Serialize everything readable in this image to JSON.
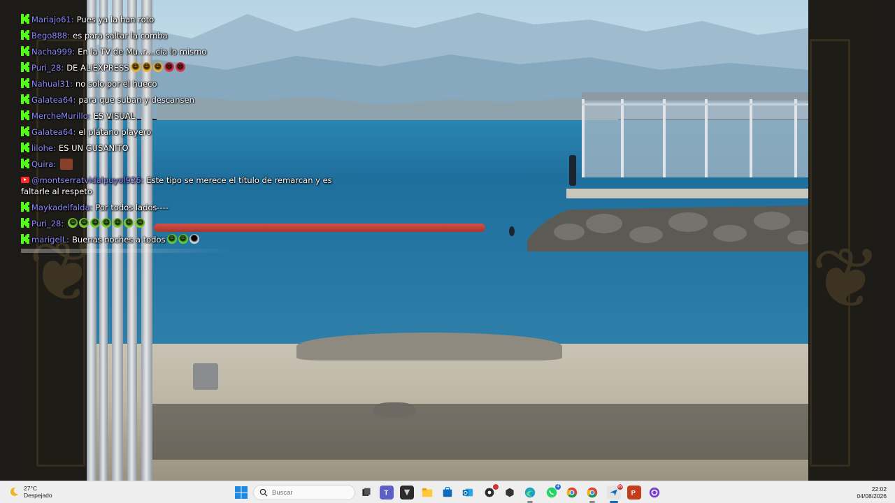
{
  "chat": {
    "messages": [
      {
        "platform": "kick",
        "user": "Mariajo61:",
        "text": "Pues ya la han roto"
      },
      {
        "platform": "kick",
        "user": "Bego888:",
        "text": "es para saltar la comba"
      },
      {
        "platform": "kick",
        "user": "Nacha999:",
        "text": "En la TV de Mu..r....cia lo mismo"
      },
      {
        "platform": "kick",
        "user": "Puri_28:",
        "text": "DE ALIEXPRESS",
        "emojis": [
          "clown",
          "clown",
          "clown",
          "angry",
          "angry"
        ]
      },
      {
        "platform": "kick",
        "user": "Nahual31:",
        "text": "no solo por el hueco"
      },
      {
        "platform": "kick",
        "user": "Galatea64:",
        "text": "para que suban y descansen"
      },
      {
        "platform": "kick",
        "user": "MercheMurillo:",
        "text": "ES VISUAL"
      },
      {
        "platform": "kick",
        "user": "Galatea64:",
        "text": "el plátano playero"
      },
      {
        "platform": "kick",
        "user": "lilohe:",
        "text": "ES UN GUSANITO"
      },
      {
        "platform": "kick",
        "user": "Quira:",
        "text": "",
        "sticker": true
      },
      {
        "platform": "youtube",
        "user": "@montserratvidalpuyol926:",
        "text": "Este tipo se merece el título de remarcan y es faltarle al respeto"
      },
      {
        "platform": "kick",
        "user": "Maykadelfalda:",
        "text": "Por todos lados----"
      },
      {
        "platform": "kick",
        "user": "Puri_28:",
        "text": "",
        "emojis": [
          "grimace",
          "grimace",
          "grimace",
          "grimace",
          "grimace",
          "grimace",
          "grimace"
        ]
      },
      {
        "platform": "kick",
        "user": "marigelL:",
        "text": "Buenas noches a todos",
        "emojis": [
          "green",
          "green",
          "alien"
        ]
      }
    ]
  },
  "taskbar": {
    "weather": {
      "temp": "27°C",
      "condition": "Despejado",
      "icon": "moon-icon"
    },
    "search": {
      "placeholder": "Buscar"
    },
    "apps": [
      "task-view",
      "teams",
      "app-dark",
      "file-explorer",
      "microsoft-store",
      "outlook",
      "app-badge",
      "app-cube",
      "edge",
      "whatsapp",
      "chrome",
      "chrome-profile",
      "remote-app",
      "powerpoint",
      "obs"
    ],
    "whatsapp_badge": "4",
    "remote_badge": "99",
    "clock": {
      "time": "22:02",
      "date": "04/08/2026"
    }
  },
  "colors": {
    "kick_green": "#53fc18",
    "username": "#8c8cff",
    "sea": "#1f6f9d",
    "boom_red": "#b43a30"
  }
}
